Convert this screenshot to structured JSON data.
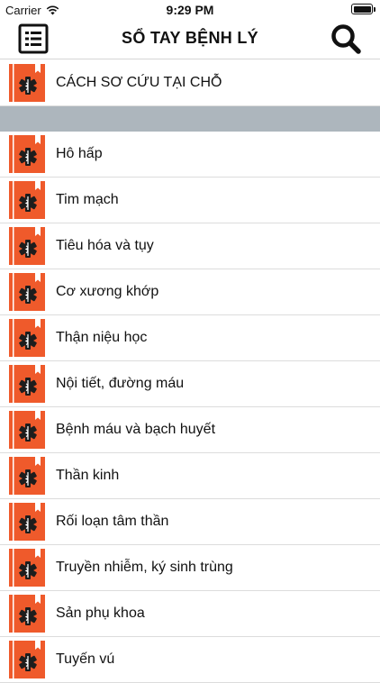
{
  "status_bar": {
    "carrier": "Carrier",
    "time": "9:29 PM"
  },
  "nav": {
    "title": "SỔ TAY BỆNH LÝ",
    "menu_icon": "list-menu-icon",
    "search_icon": "search-icon"
  },
  "colors": {
    "icon_orange": "#ef5a2b",
    "icon_dark": "#1d1d1d",
    "section_header": "#adb6bd",
    "separator": "#dcdcdc"
  },
  "first_section": {
    "items": [
      {
        "label": "CÁCH SƠ CỨU TẠI CHỖ",
        "icon": "medical-book-icon"
      }
    ]
  },
  "second_section": {
    "items": [
      {
        "label": "Hô hấp",
        "icon": "medical-book-icon"
      },
      {
        "label": "Tim mạch",
        "icon": "medical-book-icon"
      },
      {
        "label": "Tiêu hóa và tụy",
        "icon": "medical-book-icon"
      },
      {
        "label": "Cơ xương khớp",
        "icon": "medical-book-icon"
      },
      {
        "label": "Thận niệu học",
        "icon": "medical-book-icon"
      },
      {
        "label": "Nội tiết, đường máu",
        "icon": "medical-book-icon"
      },
      {
        "label": "Bệnh máu và bạch huyết",
        "icon": "medical-book-icon"
      },
      {
        "label": "Thần kinh",
        "icon": "medical-book-icon"
      },
      {
        "label": "Rối loạn tâm thần",
        "icon": "medical-book-icon"
      },
      {
        "label": "Truyền nhiễm, ký sinh trùng",
        "icon": "medical-book-icon"
      },
      {
        "label": "Sản phụ khoa",
        "icon": "medical-book-icon"
      },
      {
        "label": "Tuyến vú",
        "icon": "medical-book-icon"
      }
    ]
  }
}
